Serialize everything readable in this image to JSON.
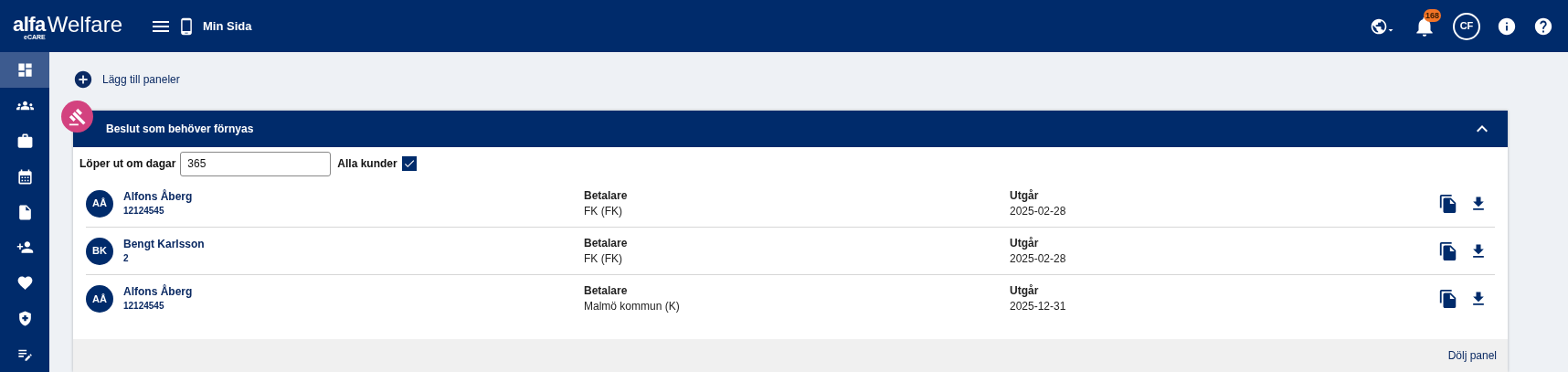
{
  "header": {
    "logo": "alfa",
    "logo_sub": "eCARE",
    "product": "Welfare",
    "page_title": "Min Sida",
    "notification_count": "168",
    "user_initials": "CF"
  },
  "sidebar": {
    "items": [
      {
        "kind": "dashboard",
        "selected": true
      },
      {
        "kind": "groups",
        "selected": false
      },
      {
        "kind": "briefcase",
        "selected": false
      },
      {
        "kind": "calendar",
        "selected": false
      },
      {
        "kind": "document",
        "selected": false
      },
      {
        "kind": "person-add",
        "selected": false
      },
      {
        "kind": "heart",
        "selected": false
      },
      {
        "kind": "shield",
        "selected": false
      },
      {
        "kind": "edit-list",
        "selected": false
      }
    ]
  },
  "add_panels": "Lägg till paneler",
  "panel": {
    "title": "Beslut som behöver förnyas",
    "expanded": true,
    "filter_label": "Löper ut om dagar",
    "filter_value": "365",
    "all_customers_label": "Alla kunder",
    "all_customers_checked": true,
    "rows": [
      {
        "initials": "AÅ",
        "name": "Alfons Åberg",
        "id": "12124545",
        "payer_label": "Betalare",
        "payer": "FK (FK)",
        "expires_label": "Utgår",
        "expires": "2025-02-28"
      },
      {
        "initials": "BK",
        "name": "Bengt Karlsson",
        "id": "2",
        "payer_label": "Betalare",
        "payer": "FK (FK)",
        "expires_label": "Utgår",
        "expires": "2025-02-28"
      },
      {
        "initials": "AÅ",
        "name": "Alfons Åberg",
        "id": "12124545",
        "payer_label": "Betalare",
        "payer": "Malmö kommun (K)",
        "expires_label": "Utgår",
        "expires": "2025-12-31"
      }
    ],
    "hide_label": "Dölj panel"
  }
}
